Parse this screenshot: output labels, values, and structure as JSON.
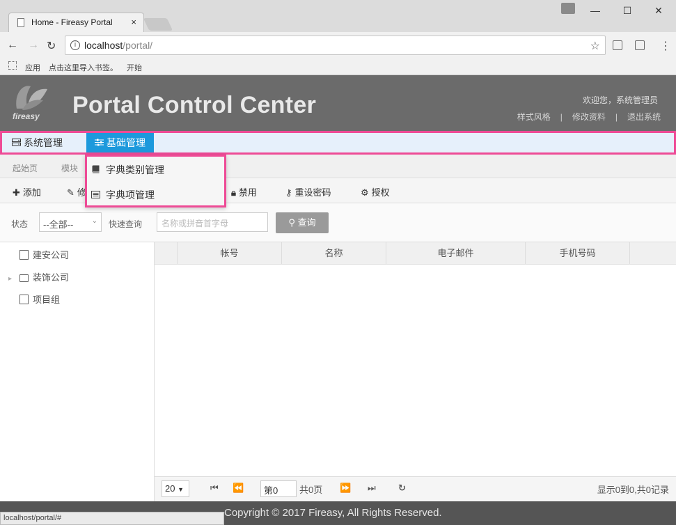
{
  "browser": {
    "tab_title": "Home - Fireasy Portal",
    "tab_close": "×",
    "url_host": "localhost",
    "url_path": "/portal/",
    "bookmarks": {
      "apps": "应用",
      "hint": "点击这里导入书签。",
      "start": "开始"
    },
    "window_controls": {
      "minimize": "—",
      "maximize": "☐",
      "close": "✕"
    }
  },
  "header": {
    "logo_text": "fireasy",
    "title": "Portal Control Center",
    "welcome": "欢迎您，系统管理员",
    "links": [
      "样式风格",
      "修改资料",
      "退出系统"
    ],
    "link_separator": "|"
  },
  "menubar": {
    "items": [
      {
        "label": "系统管理",
        "icon": "server-icon"
      },
      {
        "label": "基础管理",
        "icon": "sliders-icon",
        "active": true
      }
    ]
  },
  "dropdown": {
    "items": [
      {
        "label": "字典类别管理",
        "icon": "book-icon"
      },
      {
        "label": "字典项管理",
        "icon": "list-icon"
      }
    ]
  },
  "breadcrumb": {
    "home": "起始页",
    "current": "模块"
  },
  "toolbar": {
    "add": "添加",
    "edit": "修",
    "disable": "禁用",
    "reset_password": "重设密码",
    "authorize": "授权"
  },
  "filter": {
    "status_label": "状态",
    "status_value": "--全部--",
    "query_label": "快速查询",
    "query_placeholder": "名称或拼音首字母",
    "search_button": "查询"
  },
  "tree": {
    "nodes": [
      "建安公司",
      "装饰公司",
      "项目组"
    ]
  },
  "grid": {
    "columns": [
      "帐号",
      "名称",
      "电子邮件",
      "手机号码"
    ]
  },
  "pager": {
    "page_size": "20",
    "page_prefix": "第",
    "page_value": "0",
    "total_pages": "共0页",
    "summary": "显示0到0,共0记录"
  },
  "footer": {
    "copyright": "Copyright © 2017 Fireasy, All Rights Reserved."
  },
  "statusbar": {
    "text": "localhost/portal/#"
  },
  "colors": {
    "menu_active": "#1c99dc",
    "highlight": "#ee4b96",
    "header_bg": "#6b6b6b"
  }
}
